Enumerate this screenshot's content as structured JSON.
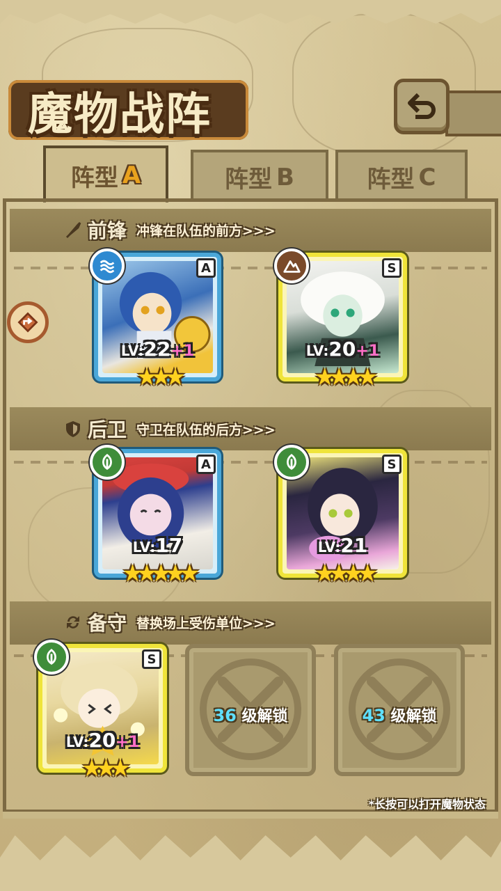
{
  "title": "魔物战阵",
  "back_button": {
    "icon": "back-arrow-icon"
  },
  "tabs": [
    {
      "label": "阵型",
      "letter": "A",
      "active": true
    },
    {
      "label": "阵型",
      "letter": "B",
      "active": false
    },
    {
      "label": "阵型",
      "letter": "C",
      "active": false
    }
  ],
  "sections": {
    "front": {
      "title": "前锋",
      "desc": "冲锋在队伍的前方>>>",
      "icon": "sword-icon"
    },
    "rear": {
      "title": "后卫",
      "desc": "守卫在队伍的后方>>>",
      "icon": "shield-icon"
    },
    "reserve": {
      "title": "备守",
      "desc": "替换场上受伤单位>>>",
      "icon": "swap-icon"
    }
  },
  "cards": {
    "front_1": {
      "rank": "A",
      "element": "water",
      "lv_label": "LV:",
      "lv": "22",
      "plus": "+1",
      "stars": 3
    },
    "front_2": {
      "rank": "S",
      "element": "earth",
      "lv_label": "LV:",
      "lv": "20",
      "plus": "+1",
      "stars": 4
    },
    "rear_1": {
      "rank": "A",
      "element": "wood",
      "lv_label": "LV:",
      "lv": "17",
      "plus": "",
      "stars": 5
    },
    "rear_2": {
      "rank": "S",
      "element": "wood",
      "lv_label": "LV:",
      "lv": "21",
      "plus": "",
      "stars": 4
    },
    "reserve_1": {
      "rank": "S",
      "element": "wood",
      "lv_label": "LV:",
      "lv": "20",
      "plus": "+1",
      "stars": 3
    }
  },
  "locked_slots": [
    {
      "level": "36",
      "text": " 级解锁"
    },
    {
      "level": "43",
      "text": " 级解锁"
    }
  ],
  "hint": "*长按可以打开魔物状态",
  "colors": {
    "rank_a_frame": "#4aa7d8",
    "rank_s_frame": "#efe43a",
    "star": "#ffd21f",
    "plus": "#ff6ec7",
    "unlock_level": "#5fe0ff"
  }
}
